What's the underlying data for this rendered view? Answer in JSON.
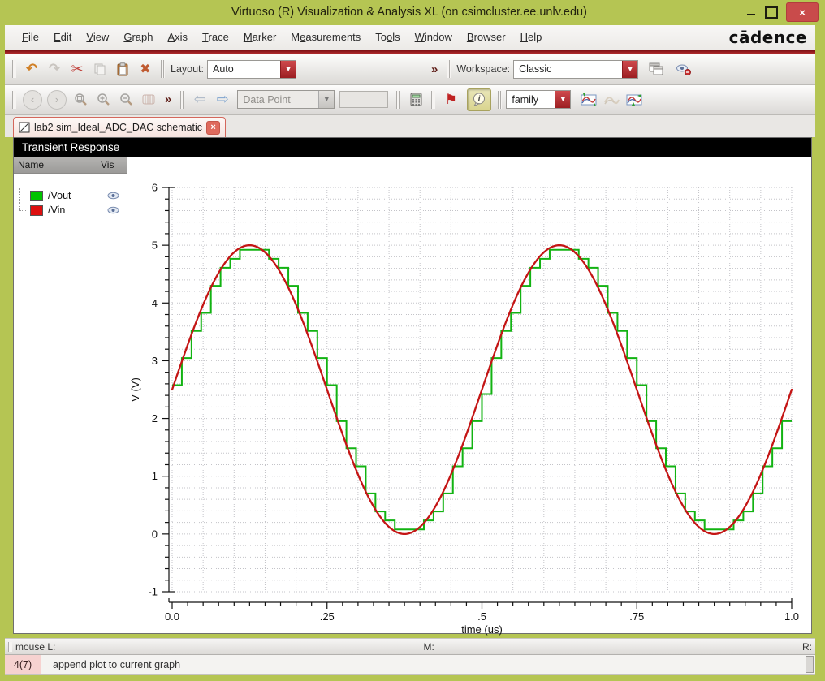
{
  "window": {
    "title": "Virtuoso (R) Visualization & Analysis XL (on csimcluster.ee.unlv.edu)",
    "border_color": "#b5c553",
    "close_color": "#c94b4b"
  },
  "menubar": {
    "items": [
      {
        "label": "File",
        "u": 0
      },
      {
        "label": "Edit",
        "u": 0
      },
      {
        "label": "View",
        "u": 0
      },
      {
        "label": "Graph",
        "u": 0
      },
      {
        "label": "Axis",
        "u": 0
      },
      {
        "label": "Trace",
        "u": 0
      },
      {
        "label": "Marker",
        "u": 0
      },
      {
        "label": "Measurements",
        "u": 1
      },
      {
        "label": "Tools",
        "u": 2
      },
      {
        "label": "Window",
        "u": 0
      },
      {
        "label": "Browser",
        "u": 0
      },
      {
        "label": "Help",
        "u": 0
      }
    ],
    "logo": "cādence"
  },
  "icons": {
    "undo": "↶",
    "redo": "↷",
    "cut": "✂",
    "delete": "✖",
    "overflow": "»",
    "prev": "‹",
    "next": "›",
    "zoom_undo": "⇦",
    "zoom_redo": "⇨",
    "flag": "⚑",
    "info": "i",
    "minimize": "–",
    "close": "×",
    "dropdown_arrow": "▼"
  },
  "toolbar1": {
    "layout_label": "Layout:",
    "layout_value": "Auto",
    "workspace_label": "Workspace:",
    "workspace_value": "Classic",
    "overflow": "»"
  },
  "toolbar2": {
    "datapoint_value": "Data Point",
    "family_value": "family",
    "overflow": "»"
  },
  "tab": {
    "label": "lab2 sim_Ideal_ADC_DAC schematic"
  },
  "graph": {
    "title": "Transient Response",
    "legend": {
      "name_header": "Name",
      "vis_header": "Vis",
      "signals": [
        {
          "label": "/Vout",
          "color": "#00c400"
        },
        {
          "label": "/Vin",
          "color": "#dd0f0f"
        }
      ]
    }
  },
  "chart_data": {
    "type": "line",
    "title": "Transient Response",
    "xlabel": "time (us)",
    "ylabel": "V (V)",
    "xlim": [
      0,
      1
    ],
    "ylim": [
      -1,
      6
    ],
    "xticks": [
      {
        "t": 0,
        "label": "0.0"
      },
      {
        "t": 0.25,
        "label": ".25"
      },
      {
        "t": 0.5,
        "label": ".5"
      },
      {
        "t": 0.75,
        "label": ".75"
      },
      {
        "t": 1,
        "label": "1.0"
      }
    ],
    "yticks": [
      -1,
      0,
      1,
      2,
      3,
      4,
      5,
      6
    ],
    "grid": {
      "x_step_us": 0.05,
      "y_step_v": 0.2,
      "style": "dotted"
    },
    "series": [
      {
        "name": "/Vin",
        "color": "#c41515",
        "type": "sine",
        "offset_v": 2.5,
        "amplitude_v": 2.5,
        "frequency_per_us": 2,
        "phase_deg": 0,
        "description": "Vin = 2.5 + 2.5*sin(2*pi*2MHz*t), two periods over 0..1us, peaks 5V at t=0.125us and 0.625us, troughs 0V at t=0.375us and 0.875us"
      },
      {
        "name": "/Vout",
        "color": "#12b312",
        "type": "staircase",
        "source": "/Vin",
        "sample_period_us": 0.015625,
        "quantization_bits": 5,
        "full_scale_v": [
          0,
          5
        ],
        "description": "ideal ADC->DAC zero-order-hold reconstruction of /Vin, 64 samples per us"
      }
    ]
  },
  "statusbar": {
    "left": "mouse L:",
    "middle": "M:",
    "right": "R:",
    "row2_badge": "4(7)",
    "row2_message": "append plot to current graph"
  }
}
